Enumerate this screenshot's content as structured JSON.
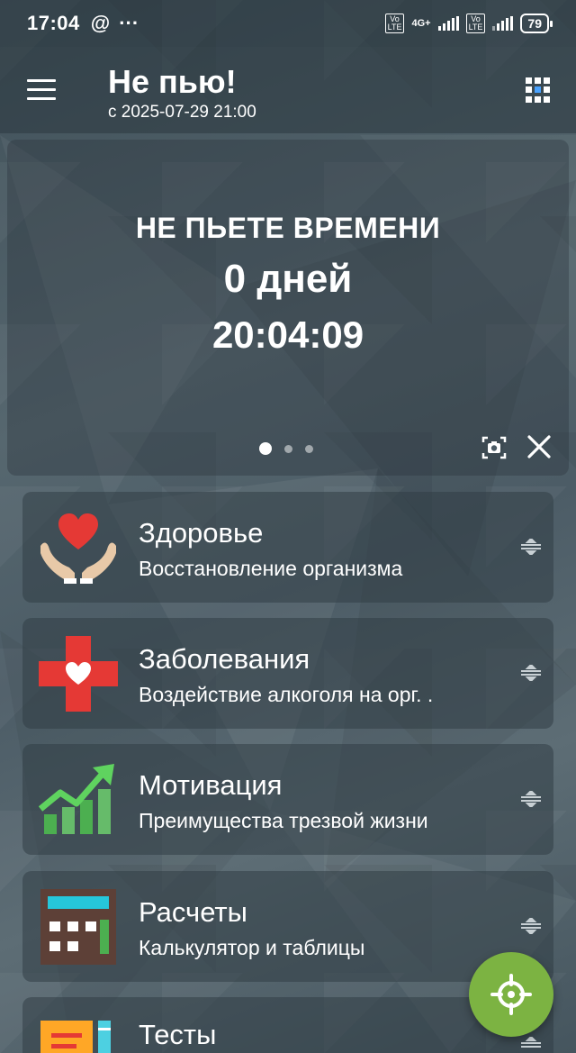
{
  "status_bar": {
    "time": "17:04",
    "at_symbol": "@",
    "more": "···",
    "volte_label": "Vo\nLTE",
    "network_type": "4G+",
    "battery": "79"
  },
  "app_bar": {
    "title": "Не пью!",
    "subtitle": "с 2025-07-29 21:00"
  },
  "counter": {
    "label": "НЕ ПЬЕТЕ ВРЕМЕНИ",
    "days": "0 дней",
    "time": "20:04:09",
    "page_index": 0,
    "page_count": 3
  },
  "cards": [
    {
      "title": "Здоровье",
      "description": "Восстановление организма",
      "icon": "heart-hands-icon"
    },
    {
      "title": "Заболевания",
      "description": "Воздействие алкоголя на орг. .",
      "icon": "medical-cross-heart-icon"
    },
    {
      "title": "Мотивация",
      "description": "Преимущества трезвой жизни",
      "icon": "growth-chart-icon"
    },
    {
      "title": "Расчеты",
      "description": "Калькулятор и таблицы",
      "icon": "calculator-icon"
    },
    {
      "title": "Тесты",
      "description": "",
      "icon": "tests-icon"
    }
  ],
  "colors": {
    "fab": "#7cb342",
    "heart_red": "#e53935",
    "chart_green": "#4caf50",
    "calculator_teal": "#26c6da",
    "tests_orange": "#ffa726"
  },
  "fab": {
    "icon": "crosshair-icon"
  }
}
